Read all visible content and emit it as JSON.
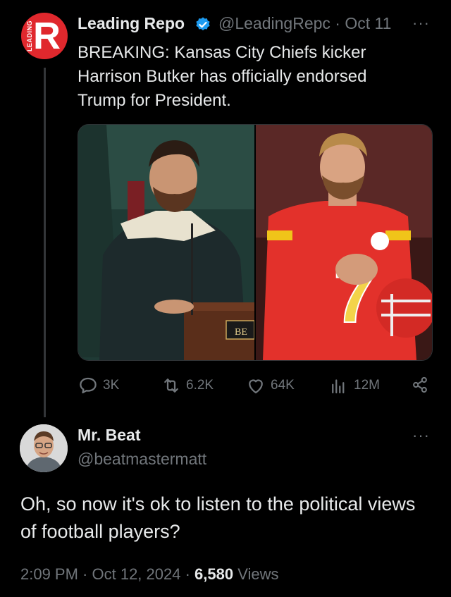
{
  "tweet": {
    "author_name": "Leading Repo",
    "avatar_letter": "R",
    "avatar_side_text": "LEADING",
    "handle": "@LeadingRepc",
    "separator": "·",
    "date": "Oct 11",
    "more": "···",
    "text": "BREAKING: Kansas City Chiefs kicker Harrison Butker has officially endorsed Trump for President.",
    "image_left_podium_text": "BE",
    "image_right_jersey_number": "7",
    "metrics": {
      "replies": "3K",
      "reposts": "6.2K",
      "likes": "64K",
      "views": "12M"
    }
  },
  "reply": {
    "author_name": "Mr. Beat",
    "handle": "@beatmastermatt",
    "more": "···",
    "text": "Oh, so now it's ok to listen to the political views of football players?",
    "time": "2:09 PM",
    "sep1": " · ",
    "date": "Oct 12, 2024",
    "sep2": " · ",
    "views_count": "6,580",
    "views_label": " Views"
  },
  "colors": {
    "background": "#000000",
    "text_primary": "#e7e9ea",
    "text_secondary": "#71767b",
    "verified_blue": "#1d9bf0",
    "brand_red": "#e0282d"
  }
}
